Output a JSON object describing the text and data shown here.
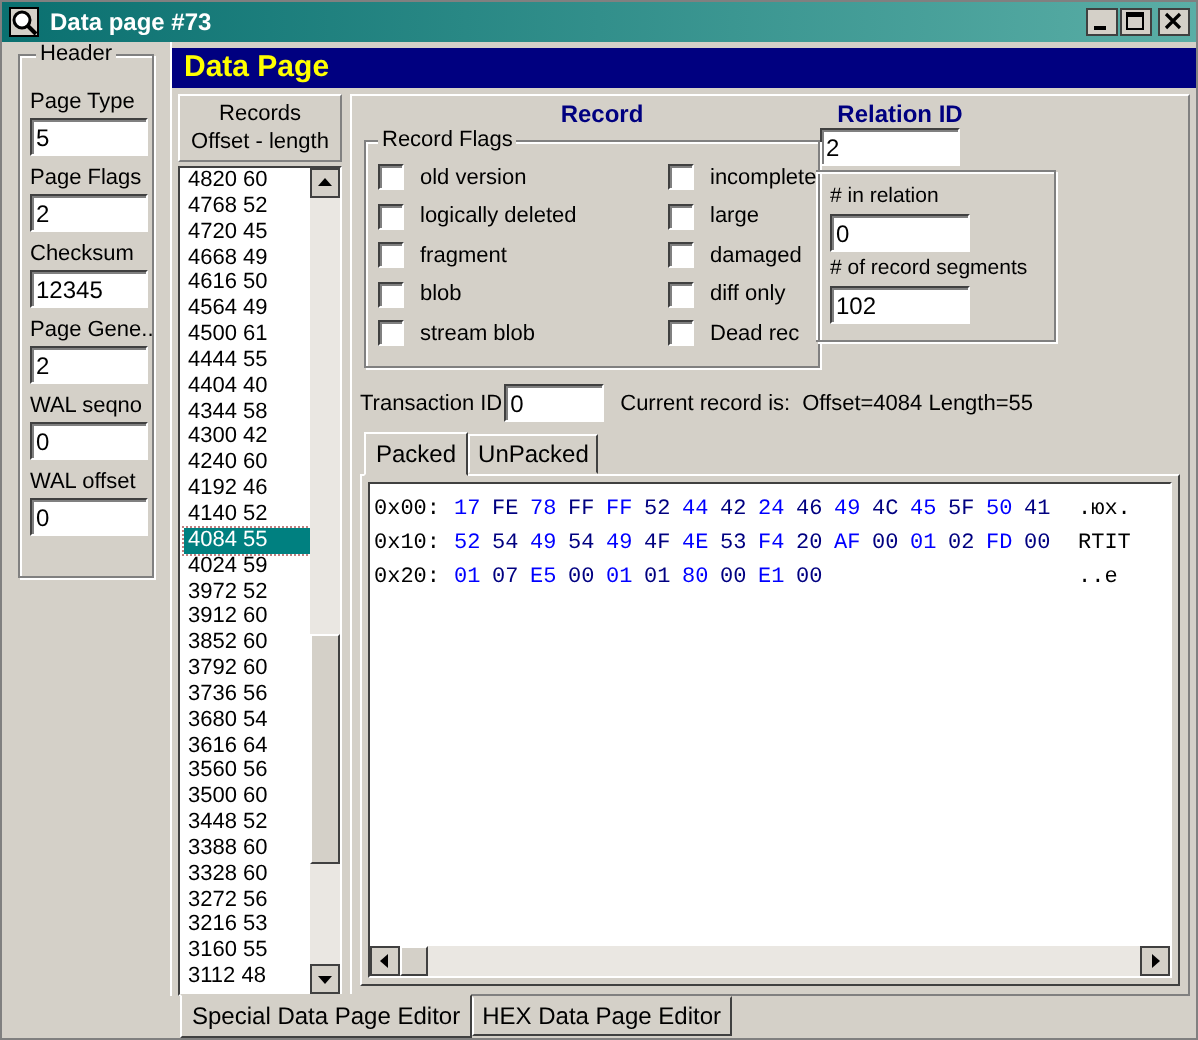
{
  "window": {
    "title": "Data page #73"
  },
  "header": {
    "title": "Header",
    "fields": [
      {
        "label": "Page Type",
        "value": "5"
      },
      {
        "label": "Page Flags",
        "value": "2"
      },
      {
        "label": "Checksum",
        "value": "12345"
      },
      {
        "label": "Page Gene..",
        "value": "2"
      },
      {
        "label": "WAL seqno",
        "value": "0"
      },
      {
        "label": "WAL offset",
        "value": "0"
      }
    ]
  },
  "banner": "Data Page",
  "records": {
    "heading": "Records",
    "subheading": "Offset  -  length",
    "items": [
      {
        "text": "4820 60",
        "selected": false
      },
      {
        "text": "4768 52",
        "selected": false
      },
      {
        "text": "4720 45",
        "selected": false
      },
      {
        "text": "4668 49",
        "selected": false
      },
      {
        "text": "4616 50",
        "selected": false
      },
      {
        "text": "4564 49",
        "selected": false
      },
      {
        "text": "4500 61",
        "selected": false
      },
      {
        "text": "4444 55",
        "selected": false
      },
      {
        "text": "4404 40",
        "selected": false
      },
      {
        "text": "4344 58",
        "selected": false
      },
      {
        "text": "4300 42",
        "selected": false
      },
      {
        "text": "4240 60",
        "selected": false
      },
      {
        "text": "4192 46",
        "selected": false
      },
      {
        "text": "4140 52",
        "selected": false
      },
      {
        "text": "4084 55",
        "selected": true
      },
      {
        "text": "4024 59",
        "selected": false
      },
      {
        "text": "3972 52",
        "selected": false
      },
      {
        "text": "3912 60",
        "selected": false
      },
      {
        "text": "3852 60",
        "selected": false
      },
      {
        "text": "3792 60",
        "selected": false
      },
      {
        "text": "3736 56",
        "selected": false
      },
      {
        "text": "3680 54",
        "selected": false
      },
      {
        "text": "3616 64",
        "selected": false
      },
      {
        "text": "3560 56",
        "selected": false
      },
      {
        "text": "3500 60",
        "selected": false
      },
      {
        "text": "3448 52",
        "selected": false
      },
      {
        "text": "3388 60",
        "selected": false
      },
      {
        "text": "3328 60",
        "selected": false
      },
      {
        "text": "3272 56",
        "selected": false
      },
      {
        "text": "3216 53",
        "selected": false
      },
      {
        "text": "3160 55",
        "selected": false
      },
      {
        "text": "3112 48",
        "selected": false
      }
    ]
  },
  "record": {
    "title": "Record",
    "flags_title": "Record Flags",
    "flags": [
      {
        "label": "old version",
        "checked": false
      },
      {
        "label": "logically deleted",
        "checked": false
      },
      {
        "label": "fragment",
        "checked": false
      },
      {
        "label": "blob",
        "checked": false
      },
      {
        "label": "stream blob",
        "checked": false
      },
      {
        "label": "incomplete",
        "checked": false
      },
      {
        "label": "large",
        "checked": false
      },
      {
        "label": "damaged",
        "checked": false
      },
      {
        "label": "diff only",
        "checked": false
      },
      {
        "label": "Dead rec",
        "checked": false
      }
    ],
    "relation_id": {
      "label": "Relation ID",
      "value": "2"
    },
    "in_relation": {
      "label": "# in relation",
      "value": "0"
    },
    "segments": {
      "label": "# of record segments",
      "value": "102"
    },
    "transaction_id": {
      "label": "Transaction ID",
      "value": "0"
    },
    "current_label": "Current record is:",
    "current_value": "Offset=4084 Length=55"
  },
  "view_tabs": [
    {
      "label": "Packed",
      "selected": true
    },
    {
      "label": "UnPacked",
      "selected": false
    }
  ],
  "hex_rows": [
    {
      "offset": "0x00:",
      "bytes": [
        "17",
        "FE",
        "78",
        "FF",
        "FF",
        "52",
        "44",
        "42",
        "24",
        "46",
        "49",
        "4C",
        "45",
        "5F",
        "50",
        "41"
      ],
      "ascii": ".юx."
    },
    {
      "offset": "0x10:",
      "bytes": [
        "52",
        "54",
        "49",
        "54",
        "49",
        "4F",
        "4E",
        "53",
        "F4",
        "20",
        "AF",
        "00",
        "01",
        "02",
        "FD",
        "00"
      ],
      "ascii": "RTIT"
    },
    {
      "offset": "0x20:",
      "bytes": [
        "01",
        "07",
        "E5",
        "00",
        "01",
        "01",
        "80",
        "00",
        "E1",
        "00"
      ],
      "ascii": "..e"
    }
  ],
  "editor_tabs": [
    {
      "label": "Special Data Page Editor",
      "selected": true
    },
    {
      "label": "HEX Data Page Editor",
      "selected": false
    }
  ]
}
